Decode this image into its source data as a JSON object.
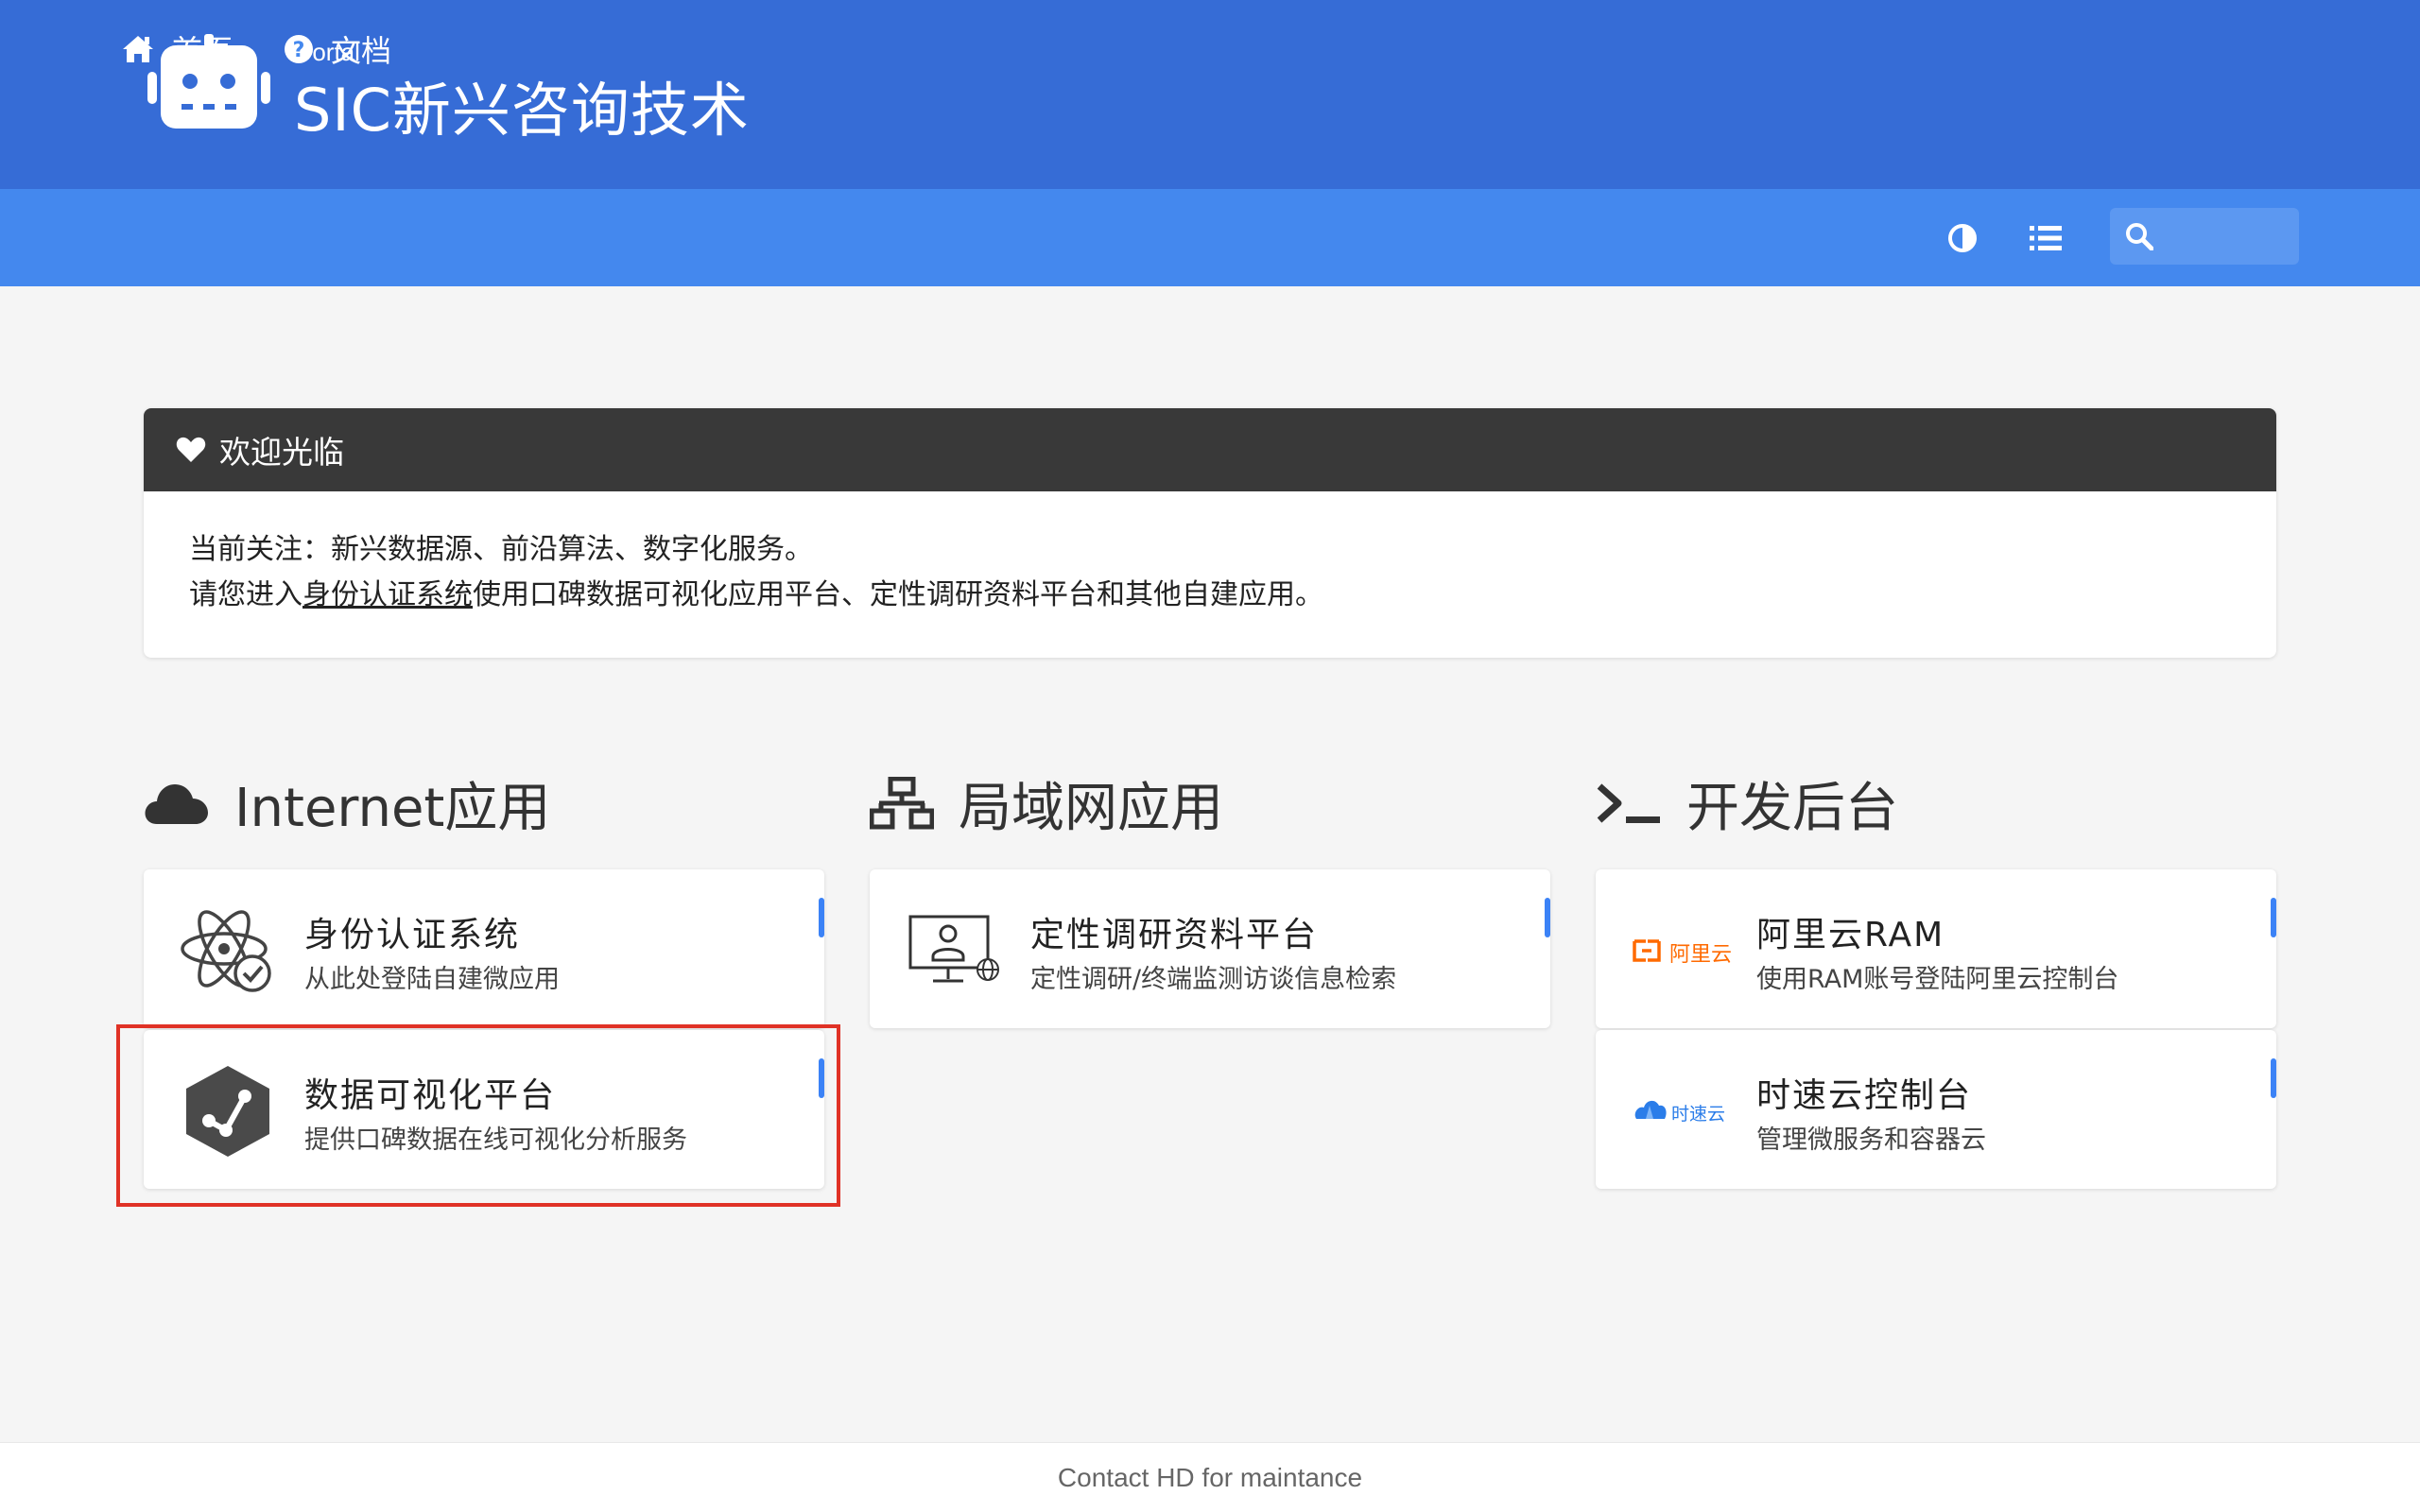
{
  "header": {
    "subtitle": "Portal",
    "title": "SIC新兴咨询技术",
    "logo_icon": "robot-icon"
  },
  "nav": {
    "home_label": "首页",
    "docs_label": "文档",
    "search_placeholder": ""
  },
  "welcome": {
    "heading": "欢迎光临",
    "line1": "当前关注：新兴数据源、前沿算法、数字化服务。",
    "line2_prefix": "请您进入",
    "line2_link": "身份认证系统",
    "line2_suffix": "使用口碑数据可视化应用平台、定性调研资料平台和其他自建应用。"
  },
  "sections": [
    {
      "title": "Internet应用",
      "icon": "cloud-icon",
      "cards": [
        {
          "title": "身份认证系统",
          "desc": "从此处登陆自建微应用",
          "icon": "atom-check-icon"
        },
        {
          "title": "数据可视化平台",
          "desc": "提供口碑数据在线可视化分析服务",
          "icon": "hexagon-graph-icon"
        }
      ]
    },
    {
      "title": "局域网应用",
      "icon": "network-icon",
      "cards": [
        {
          "title": "定性调研资料平台",
          "desc": "定性调研/终端监测访谈信息检索",
          "icon": "monitor-user-icon"
        }
      ]
    },
    {
      "title": "开发后台",
      "icon": "terminal-icon",
      "cards": [
        {
          "title": "阿里云RAM",
          "desc": "使用RAM账号登陆阿里云控制台",
          "icon": "aliyun-logo",
          "logo_text": "阿里云"
        },
        {
          "title": "时速云控制台",
          "desc": "管理微服务和容器云",
          "icon": "tenxcloud-logo",
          "logo_text": "时速云"
        }
      ]
    }
  ],
  "footer": {
    "text": "Contact HD for maintance"
  },
  "colors": {
    "topbar": "#366cd6",
    "navbar": "#4488ee",
    "accent": "#3b82f6",
    "highlight": "#e03226",
    "aliyun": "#ff6a00"
  }
}
